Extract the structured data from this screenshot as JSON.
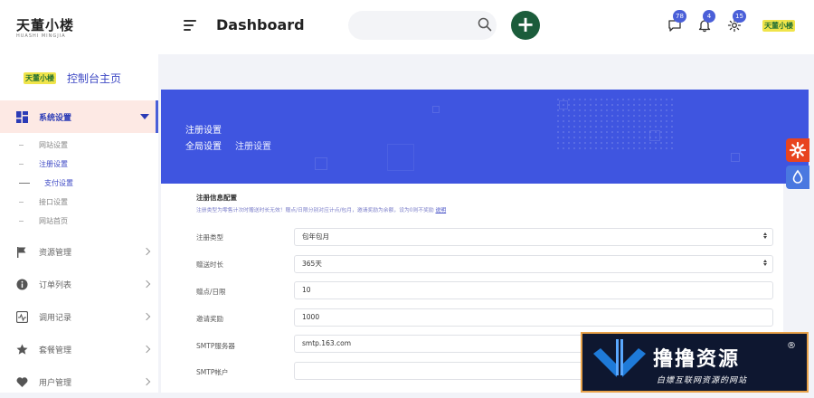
{
  "brand": {
    "logo_text": "天董小楼",
    "logo_sub": "HUASHI MINGJIA",
    "mini_logo": "天董小楼"
  },
  "header": {
    "title": "Dashboard",
    "search_placeholder": "",
    "badges": {
      "messages": "78",
      "notifications": "4",
      "settings": "15"
    }
  },
  "sidebar": {
    "home_label": "控制台主页",
    "items": [
      {
        "label": "系统设置",
        "icon": "dashboard-grid-icon"
      },
      {
        "label": "资源管理",
        "icon": "flag-icon"
      },
      {
        "label": "订单列表",
        "icon": "info-icon"
      },
      {
        "label": "调用记录",
        "icon": "activity-icon"
      },
      {
        "label": "套餐管理",
        "icon": "star-icon"
      },
      {
        "label": "用户管理",
        "icon": "heart-icon"
      }
    ],
    "subitems": [
      {
        "label": "网站设置"
      },
      {
        "label": "注册设置"
      },
      {
        "label": "支付设置"
      },
      {
        "label": "接口设置"
      },
      {
        "label": "网站首页"
      }
    ]
  },
  "banner": {
    "title": "注册设置",
    "crumb_1": "全局设置",
    "crumb_2": "注册设置"
  },
  "form": {
    "section_title": "注册信息配置",
    "section_desc": "注册类型为零售计次时赠送时长无效！赠点/日限分别对应计点/包月，邀请奖励为余额，设为0则不奖励",
    "desc_link": "说明",
    "fields": [
      {
        "label": "注册类型",
        "value": "包年包月"
      },
      {
        "label": "赠送时长",
        "value": "365天"
      },
      {
        "label": "赠点/日限",
        "value": "10"
      },
      {
        "label": "邀请奖励",
        "value": "1000"
      },
      {
        "label": "SMTP服务器",
        "value": "smtp.163.com"
      },
      {
        "label": "SMTP帐户",
        "value": ""
      }
    ]
  },
  "watermark": {
    "title": "撸撸资源",
    "subtitle": "白嫖互联网资源的网站",
    "reg": "®"
  },
  "colors": {
    "primary": "#3f55e0",
    "add_button": "#1b5c3b",
    "float_settings": "#e8441f",
    "float_drop": "#4a78e0"
  }
}
